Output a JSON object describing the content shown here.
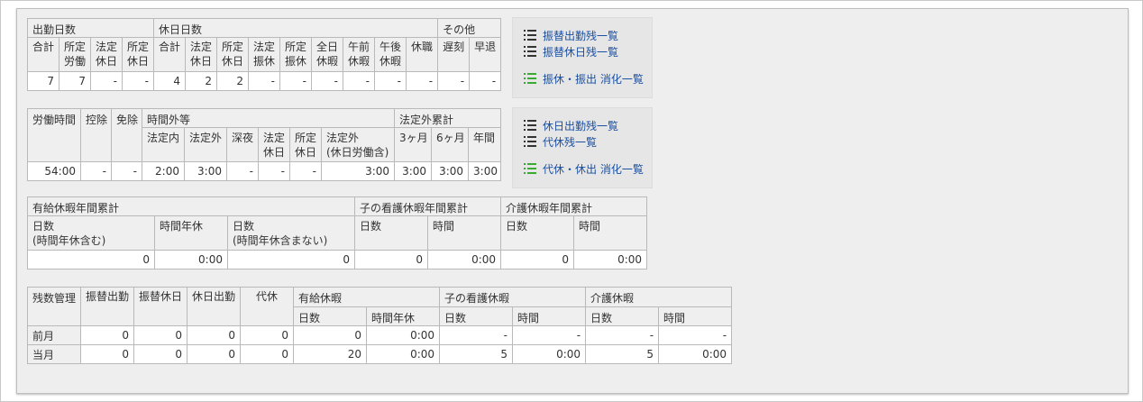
{
  "attendance": {
    "group_headers": [
      "出勤日数",
      "休日日数",
      "その他"
    ],
    "sub_headers": [
      "合計",
      "所定\n労働",
      "法定\n休日",
      "所定\n休日",
      "合計",
      "法定\n休日",
      "所定\n休日",
      "法定\n振休",
      "所定\n振休",
      "全日\n休暇",
      "午前\n休暇",
      "午後\n休暇",
      "休職",
      "遅刻",
      "早退"
    ],
    "values": [
      "7",
      "7",
      "-",
      "-",
      "4",
      "2",
      "2",
      "-",
      "-",
      "-",
      "-",
      "-",
      "-",
      "-",
      "-"
    ]
  },
  "hours": {
    "col_labor": "労働時間",
    "col_deduct": "控除",
    "col_exempt": "免除",
    "group_overtime": "時間外等",
    "group_cumulative": "法定外累計",
    "sub_headers": [
      "法定内",
      "法定外",
      "深夜",
      "法定\n休日",
      "所定\n休日",
      "法定外\n(休日労働含)",
      "3ヶ月",
      "6ヶ月",
      "年間"
    ],
    "values": [
      "54:00",
      "-",
      "-",
      "2:00",
      "3:00",
      "-",
      "-",
      "-",
      "3:00",
      "3:00",
      "3:00",
      "3:00"
    ]
  },
  "leave_annual": {
    "group_headers": [
      "有給休暇年間累計",
      "子の看護休暇年間累計",
      "介護休暇年間累計"
    ],
    "sub_headers": [
      "日数\n(時間年休含む)",
      "時間年休",
      "日数\n(時間年休含まない)",
      "日数",
      "時間",
      "日数",
      "時間"
    ],
    "values": [
      "0",
      "0:00",
      "0",
      "0",
      "0:00",
      "0",
      "0:00"
    ]
  },
  "balance": {
    "col_headers": [
      "残数管理",
      "振替出勤",
      "振替休日",
      "休日出勤",
      "代休"
    ],
    "group_headers": [
      "有給休暇",
      "子の看護休暇",
      "介護休暇"
    ],
    "sub_headers": [
      "日数",
      "時間年休",
      "日数",
      "時間",
      "日数",
      "時間"
    ],
    "rows": [
      {
        "label": "前月",
        "values": [
          "0",
          "0",
          "0",
          "0",
          "0",
          "0:00",
          "-",
          "-",
          "-",
          "-"
        ]
      },
      {
        "label": "当月",
        "values": [
          "0",
          "0",
          "0",
          "0",
          "20",
          "0:00",
          "5",
          "0:00",
          "5",
          "0:00"
        ]
      }
    ]
  },
  "links_top": {
    "items": [
      "振替出勤残一覧",
      "振替休日残一覧"
    ],
    "digest": "振休・振出 消化一覧"
  },
  "links_bottom": {
    "items": [
      "休日出勤残一覧",
      "代休残一覧"
    ],
    "digest": "代休・休出 消化一覧"
  },
  "colors": {
    "link": "#1a4fa0",
    "digest_icon": "#3aaa35",
    "header_bg": "#efefef",
    "panel_bg": "#eeeeee"
  }
}
